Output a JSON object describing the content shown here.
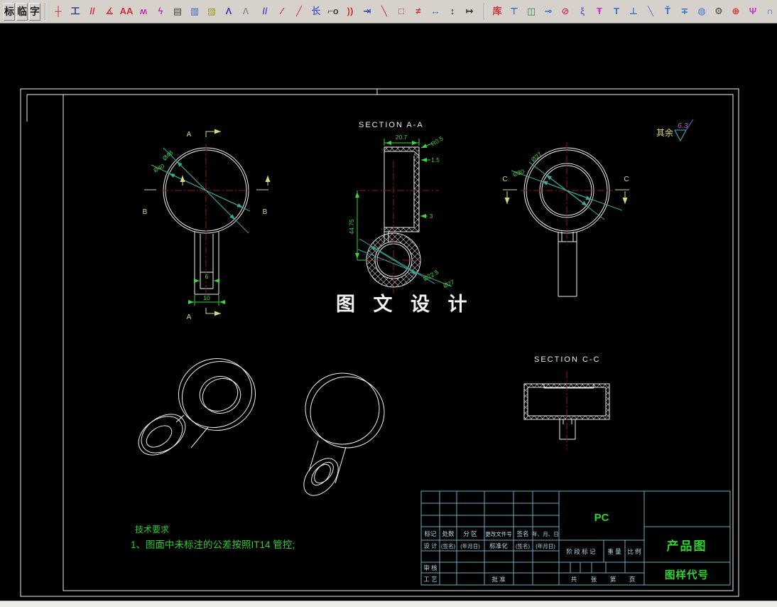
{
  "toolbar": {
    "text_buttons": [
      {
        "name": "toolbar-button-biao",
        "label": "标"
      },
      {
        "name": "toolbar-button-lin",
        "label": "临"
      },
      {
        "name": "toolbar-button-zi",
        "label": "字"
      }
    ],
    "groups": [
      {
        "name": "dimension-tools",
        "items": [
          {
            "name": "dimension-icon",
            "glyph": "┼",
            "color": "#cc2222"
          },
          {
            "name": "baseline-dimension-icon",
            "glyph": "工",
            "color": "#334499"
          },
          {
            "name": "parallel-lines-icon",
            "glyph": "//",
            "color": "#cc3333"
          },
          {
            "name": "angle-dimension-icon",
            "glyph": "∡",
            "color": "#cc3333"
          },
          {
            "name": "text-style-icon",
            "glyph": "AA",
            "color": "#cc3333"
          },
          {
            "name": "polyline-dimension-icon",
            "glyph": "ʍ",
            "color": "#b833b8"
          },
          {
            "name": "leader-zigzag-icon",
            "glyph": "ϟ",
            "color": "#b833b8"
          },
          {
            "name": "break-view-icon",
            "glyph": "▤",
            "color": "#444444"
          },
          {
            "name": "hatch-blue-icon",
            "glyph": "▥",
            "color": "#3366bb"
          },
          {
            "name": "hatch-yellow-icon",
            "glyph": "▨",
            "color": "#a8a030"
          },
          {
            "name": "chamfer-icon",
            "glyph": "Λ",
            "color": "#3344bb"
          },
          {
            "name": "chamfer-dim-icon",
            "glyph": "Λ",
            "color": "#909090"
          }
        ]
      },
      {
        "name": "annotation-tools",
        "items": [
          {
            "name": "section-lines-icon",
            "glyph": "//",
            "color": "#4455bb"
          },
          {
            "name": "half-line-icon",
            "glyph": "∕",
            "color": "#cc3333"
          },
          {
            "name": "line-icon",
            "glyph": "╱",
            "color": "#cc3333"
          },
          {
            "name": "length-dimension-icon",
            "glyph": "长",
            "color": "#5566cc"
          },
          {
            "name": "leader-hook-icon",
            "glyph": "⌐o",
            "color": "#444444"
          },
          {
            "name": "double-arc-icon",
            "glyph": "))",
            "color": "#cc3333"
          },
          {
            "name": "datum-arrow-icon",
            "glyph": "⇥",
            "color": "#3344cc"
          },
          {
            "name": "slope-line-icon",
            "glyph": "╲",
            "color": "#cc3333"
          },
          {
            "name": "rect-leader-icon",
            "glyph": "□",
            "color": "#cc4444"
          },
          {
            "name": "double-strike-icon",
            "glyph": "≠",
            "color": "#cc3333"
          },
          {
            "name": "horizontal-span-icon",
            "glyph": "↔",
            "color": "#3366cc"
          },
          {
            "name": "vertical-span-icon",
            "glyph": "↕",
            "color": "#333333"
          },
          {
            "name": "limit-span-icon",
            "glyph": "↦",
            "color": "#333333"
          }
        ]
      },
      {
        "name": "library-tools",
        "items": [
          {
            "name": "library-icon",
            "glyph": "库",
            "color": "#cc3333"
          },
          {
            "name": "tap-tool-icon",
            "glyph": "⊤",
            "color": "#3377cc"
          },
          {
            "name": "frame-part-icon",
            "glyph": "◫",
            "color": "#228844"
          },
          {
            "name": "shaft-icon",
            "glyph": "⊸",
            "color": "#3377cc"
          },
          {
            "name": "bearing-section-icon",
            "glyph": "⊘",
            "color": "#cc3366"
          },
          {
            "name": "spring-icon",
            "glyph": "ξ",
            "color": "#7755cc"
          },
          {
            "name": "bolt-icon",
            "glyph": "Ŧ",
            "color": "#cc33cc"
          },
          {
            "name": "t-bolt-icon",
            "glyph": "T",
            "color": "#3377cc"
          },
          {
            "name": "pin-icon",
            "glyph": "⊥",
            "color": "#3377cc"
          },
          {
            "name": "hatch-lines-icon",
            "glyph": "╲",
            "color": "#6677cc"
          },
          {
            "name": "screw-icon",
            "glyph": "Ť",
            "color": "#3377cc"
          },
          {
            "name": "stud-icon",
            "glyph": "∓",
            "color": "#3377cc"
          },
          {
            "name": "bearing-icon",
            "glyph": "◍",
            "color": "#4477cc"
          },
          {
            "name": "chain-wheel-icon",
            "glyph": "⚙",
            "color": "#444444"
          },
          {
            "name": "crosshair-icon",
            "glyph": "⊕",
            "color": "#cc3333"
          },
          {
            "name": "countersunk-screw-icon",
            "glyph": "Ψ",
            "color": "#cc33cc"
          },
          {
            "name": "belt-pulley-icon",
            "glyph": "∩",
            "color": "#3377cc"
          }
        ]
      }
    ]
  },
  "drawing": {
    "front_view": {
      "section_label_a": "A",
      "section_label_b": "B",
      "dia_outer": "Ø48",
      "dia_inner": "Ø40",
      "slot_width": "6",
      "stem_width": "10"
    },
    "section_aa": {
      "title": "SECTION A-A",
      "width": "20.7",
      "fillet": "R0.5",
      "wall": "1.5",
      "step": "3",
      "height": "44.75",
      "bore_dia": "Ø22.5",
      "hub_dia": "Ø27"
    },
    "side_view": {
      "section_label_c": "C",
      "inner_dia": "Ø27",
      "hub_dia": "Ø30"
    },
    "section_cc": {
      "title": "SECTION C-C"
    },
    "surface_note": {
      "prefix": "其余",
      "roughness": "6.3"
    },
    "watermark": "图 文 设 计",
    "tech_requirements": {
      "title": "技术要求",
      "line1": "1、图面中未标注的公差按照IT14 管控;"
    }
  },
  "title_block": {
    "revision_headers": [
      "标记",
      "处数",
      "分 区",
      "更改文件号",
      "签名",
      "年、月、日"
    ],
    "design_row": [
      "设 计",
      "(签名)",
      "(年月日)",
      "标准化",
      "(签名)",
      "(年月日)"
    ],
    "review_label": "审 核",
    "process_label": "工 艺",
    "approve_label": "批 准",
    "stage_label": "阶 段 标 记",
    "weight_label": "重 量",
    "scale_label": "比 例",
    "sheets_label": "共",
    "sheets_unit": "张",
    "page_label": "第",
    "page_unit": "页",
    "material": "PC",
    "drawing_name": "产品图",
    "drawing_code": "图样代号"
  },
  "colors": {
    "centerline": "#a11212",
    "dimension_green": "#3fd43f",
    "leader_teal": "#3aa79b",
    "section_yellow": "#d9d985",
    "titleblock_line": "#6ea9c2",
    "titleblock_text": "#b9dcea",
    "label_green": "#2ed52e",
    "roughness_magenta": "#cc55cc"
  }
}
